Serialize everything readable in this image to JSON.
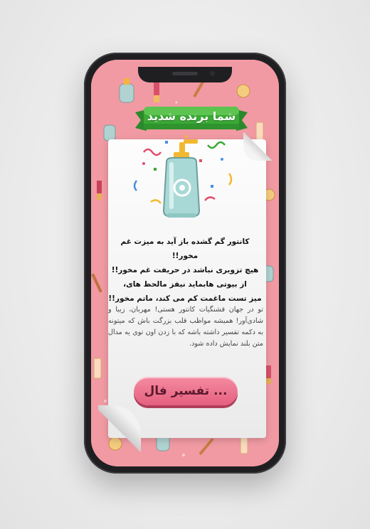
{
  "banner": {
    "title": "شما برنده شدید"
  },
  "poem": {
    "lines": [
      "کانتور گم گشده باز آید به میزت غم مخور!!",
      "هیچ تزویری نباشد در حریفت غم مخور!!",
      "از بیوتی هابماید نیفز مالحظ های،",
      "میز تست ماغمت کم می کند، ماتم مخور!!"
    ]
  },
  "description": "تو در جهان قشنگیات کانتور هستی! مهربان، زیبا و شادی‌آور! همیشه مواظب قلب بزرگت باش که میتونه به دکمه تفسیر داشته باشه که با زدن اون توی یه مدال متن بلند نمایش داده شود.",
  "button": {
    "label": "تفسیر فال ..."
  },
  "icons": {
    "ribbon": "green-ribbon-banner",
    "bottle": "pump-bottle-icon",
    "confetti": "confetti-icon"
  },
  "colors": {
    "background_pink": "#f19aa3",
    "ribbon_green": "#3aa935",
    "button_pink": "#e5607f",
    "bottle_teal": "#a9d9d6",
    "bottle_pump": "#f2b832"
  }
}
